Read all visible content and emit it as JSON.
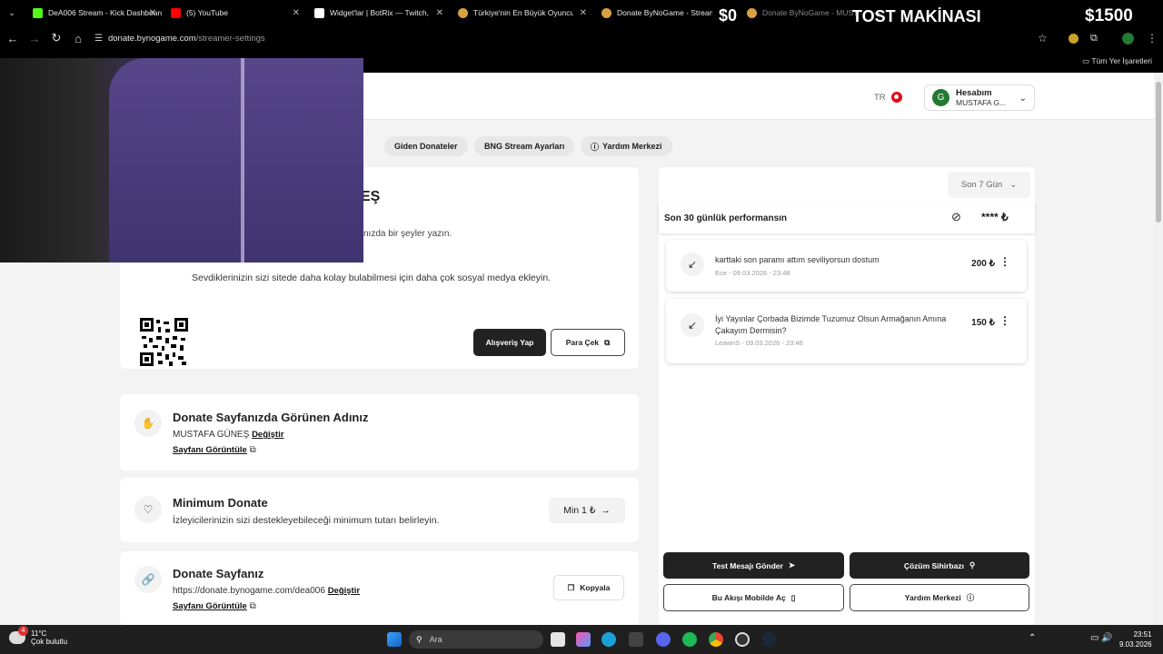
{
  "browser": {
    "tabs": [
      {
        "title": "DeA006 Stream - Kick Dashboard",
        "color": "#53fc18"
      },
      {
        "title": "(5) YouTube",
        "color": "#ff0000"
      },
      {
        "title": "Widget'lar | BotRix — Twitch, Ki",
        "color": "#ffffff"
      },
      {
        "title": "Türkiye'nin En Büyük Oyuncu D",
        "color": "#d8a040"
      },
      {
        "title": "Donate ByNoGame - Streamer",
        "color": "#d8a040"
      },
      {
        "title": "Donate ByNoGame - MUSTAFA",
        "color": "#d8a040"
      }
    ],
    "new_tab": "+",
    "url_host": "donate.bynogame.com",
    "url_path": "/streamer-settings",
    "bookmarks_label": "Tüm Yer İşaretleri"
  },
  "overlay": {
    "left_amount": "$0",
    "title": "TOST MAKİNASI",
    "right_amount": "$1500"
  },
  "header": {
    "lang": "TR",
    "account_title": "Hesabım",
    "account_name": "MUSTAFA G...",
    "avatar_letter": "G"
  },
  "nav": {
    "item_partial": "ler",
    "item1": "Giden Donateler",
    "item2": "BNG Stream Ayarları",
    "item3": "Yardım Merkezi"
  },
  "profile": {
    "name_partial": "EŞ",
    "desc_partial": "nızda bir şeyler yazın.",
    "social_text": "Sevdiklerinizin sizi sitede daha kolay bulabilmesi için daha çok sosyal medya ekleyin.",
    "shop_button": "Alışveriş Yap",
    "withdraw_button": "Para Çek"
  },
  "display_name": {
    "title": "Donate Sayfanızda Görünen Adınız",
    "value": "MUSTAFA GÜNEŞ",
    "change": "Değiştir",
    "view": "Sayfanı Görüntüle"
  },
  "minimum": {
    "title": "Minimum Donate",
    "desc": "İzleyicilerinizin sizi destekleyebileceği minimum tutarı belirleyin.",
    "value": "Min 1 ₺"
  },
  "donate_page": {
    "title": "Donate Sayfanız",
    "url": "https://donate.bynogame.com/dea006",
    "change": "Değiştir",
    "view": "Sayfanı Görüntüle",
    "copy": "Kopyala"
  },
  "stats": {
    "period": "Son 7 Gün",
    "performance_label": "Son 30 günlük performansın",
    "hidden_value": "****"
  },
  "donations": [
    {
      "message": "karttaki son paramı attım seviliyorsun dostum",
      "user": "Ece",
      "date": "09.03.2026 - 23:48",
      "amount": "200 ₺"
    },
    {
      "message": "İyi Yayınlar Çorbada Bizimde Tuzumuz Olsun Armağanın Amına Çakayım Dermisin?",
      "user": "LeawnS",
      "date": "09.03.2026 - 23:46",
      "amount": "150 ₺"
    }
  ],
  "actions": {
    "test": "Test Mesajı Gönder",
    "wizard": "Çözüm Sihirbazı",
    "mobile": "Bu Akışı Mobilde Aç",
    "help": "Yardım Merkezi"
  },
  "taskbar": {
    "temp": "11°C",
    "weather": "Çok bulutlu",
    "search": "Ara",
    "time": "23:51",
    "date": "9.03.2026",
    "badge": "4"
  }
}
